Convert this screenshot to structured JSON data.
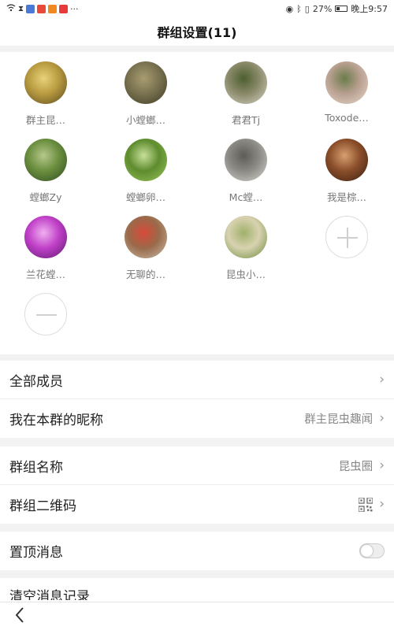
{
  "status": {
    "battery": "27%",
    "time": "晚上9:57"
  },
  "header": {
    "title": "群组设置(11)"
  },
  "members": [
    {
      "name": "群主昆…",
      "colors": [
        "#5a4a1e",
        "#b89a40",
        "#e8d27a"
      ]
    },
    {
      "name": "小螳螂…",
      "colors": [
        "#3e3a24",
        "#7a7250",
        "#a89c70"
      ]
    },
    {
      "name": "君君Tj",
      "colors": [
        "#d8d2c8",
        "#8a8a6a",
        "#4c5e2e"
      ]
    },
    {
      "name": "Toxode…",
      "colors": [
        "#e8d8cc",
        "#b8a090",
        "#6a7c4a"
      ]
    },
    {
      "name": "螳螂Zy",
      "colors": [
        "#2e4a22",
        "#6a8e3e",
        "#b6c88c"
      ]
    },
    {
      "name": "螳螂卵…",
      "colors": [
        "#9ac45c",
        "#5e8c2e",
        "#c8e09a"
      ]
    },
    {
      "name": "Mc螳…",
      "colors": [
        "#d6d6d0",
        "#8c8a84",
        "#5e5c56"
      ]
    },
    {
      "name": "我是棕…",
      "colors": [
        "#3a1e12",
        "#8a4e2a",
        "#d8a070"
      ]
    },
    {
      "name": "兰花螳…",
      "colors": [
        "#5a1a6a",
        "#c040c8",
        "#f0b0f0"
      ]
    },
    {
      "name": "无聊的…",
      "colors": [
        "#c8c0b0",
        "#9a6a4a",
        "#d84a3a"
      ]
    },
    {
      "name": "昆虫小…",
      "colors": [
        "#6a8a3a",
        "#d8d2b0",
        "#a0b06a"
      ]
    }
  ],
  "settings": {
    "all_members": "全部成员",
    "my_nickname_label": "我在本群的昵称",
    "my_nickname_value": "群主昆虫趣闻",
    "group_name_label": "群组名称",
    "group_name_value": "昆虫圈",
    "group_qr_label": "群组二维码",
    "pin_label": "置顶消息",
    "clear_label": "清空消息记录"
  }
}
